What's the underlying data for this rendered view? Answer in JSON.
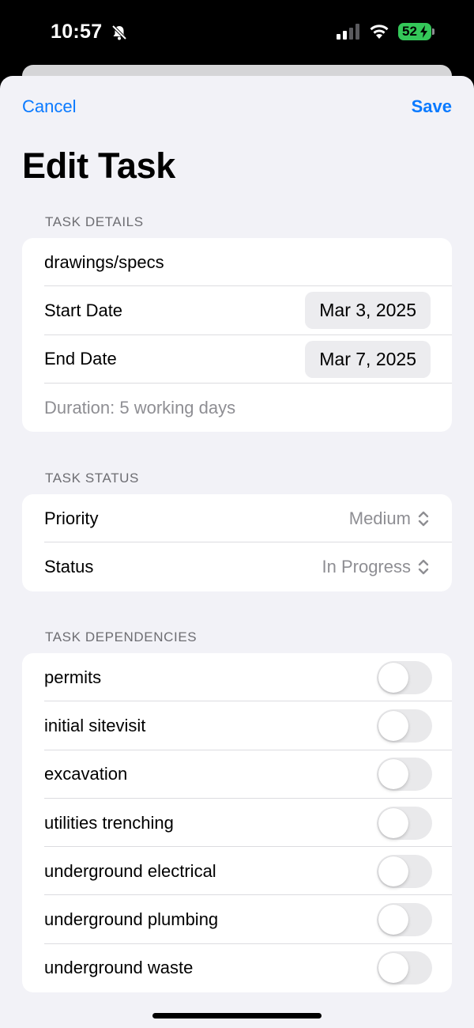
{
  "status_bar": {
    "time": "10:57",
    "battery": "52",
    "colors": {
      "battery": "#34c759"
    }
  },
  "nav": {
    "cancel_label": "Cancel",
    "save_label": "Save",
    "accent_color": "#0a7aff"
  },
  "title": "Edit Task",
  "details": {
    "header": "TASK DETAILS",
    "task_name": "drawings/specs",
    "start_label": "Start Date",
    "start_value": "Mar 3, 2025",
    "end_label": "End Date",
    "end_value": "Mar 7, 2025",
    "duration": "Duration: 5 working days"
  },
  "status_section": {
    "header": "TASK STATUS",
    "priority_label": "Priority",
    "priority_value": "Medium",
    "status_label": "Status",
    "status_value": "In Progress"
  },
  "dependencies": {
    "header": "TASK DEPENDENCIES",
    "items": [
      {
        "label": "permits",
        "enabled": false
      },
      {
        "label": "initial sitevisit",
        "enabled": false
      },
      {
        "label": "excavation",
        "enabled": false
      },
      {
        "label": "utilities trenching",
        "enabled": false
      },
      {
        "label": "underground electrical",
        "enabled": false
      },
      {
        "label": "underground plumbing",
        "enabled": false
      },
      {
        "label": "underground waste",
        "enabled": false
      }
    ]
  }
}
